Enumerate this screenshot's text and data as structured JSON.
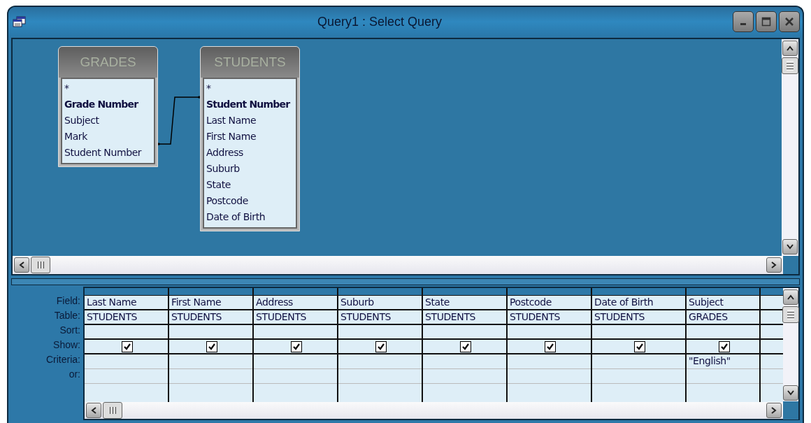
{
  "window": {
    "title": "Query1 : Select Query"
  },
  "tables": [
    {
      "name": "GRADES",
      "fields": [
        {
          "name": "*",
          "key": false
        },
        {
          "name": "Grade Number",
          "key": true
        },
        {
          "name": "Subject",
          "key": false
        },
        {
          "name": "Mark",
          "key": false
        },
        {
          "name": "Student Number",
          "key": false
        }
      ]
    },
    {
      "name": "STUDENTS",
      "fields": [
        {
          "name": "*",
          "key": false
        },
        {
          "name": "Student Number",
          "key": true
        },
        {
          "name": "Last Name",
          "key": false
        },
        {
          "name": "First Name",
          "key": false
        },
        {
          "name": "Address",
          "key": false
        },
        {
          "name": "Suburb",
          "key": false
        },
        {
          "name": "State",
          "key": false
        },
        {
          "name": "Postcode",
          "key": false
        },
        {
          "name": "Date of Birth",
          "key": false
        }
      ]
    }
  ],
  "grid": {
    "row_labels": [
      "Field:",
      "Table:",
      "Sort:",
      "Show:",
      "Criteria:",
      "or:"
    ],
    "columns": [
      {
        "field": "Last Name",
        "table": "STUDENTS",
        "show": true
      },
      {
        "field": "First Name",
        "table": "STUDENTS",
        "show": true
      },
      {
        "field": "Address",
        "table": "STUDENTS",
        "show": true
      },
      {
        "field": "Suburb",
        "table": "STUDENTS",
        "show": true
      },
      {
        "field": "State",
        "table": "STUDENTS",
        "show": true
      },
      {
        "field": "Postcode",
        "table": "STUDENTS",
        "show": true
      },
      {
        "field": "Date of Birth",
        "table": "STUDENTS",
        "show": true
      },
      {
        "field": "Subject",
        "table": "GRADES",
        "show": true,
        "criteria": "\"English\""
      }
    ]
  }
}
